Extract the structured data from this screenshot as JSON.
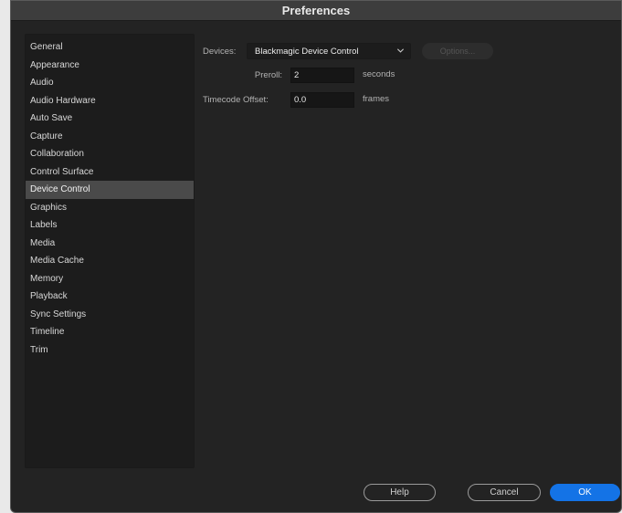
{
  "window": {
    "title": "Preferences"
  },
  "sidebar": {
    "items": [
      {
        "label": "General"
      },
      {
        "label": "Appearance"
      },
      {
        "label": "Audio"
      },
      {
        "label": "Audio Hardware"
      },
      {
        "label": "Auto Save"
      },
      {
        "label": "Capture"
      },
      {
        "label": "Collaboration"
      },
      {
        "label": "Control Surface"
      },
      {
        "label": "Device Control",
        "selected": true
      },
      {
        "label": "Graphics"
      },
      {
        "label": "Labels"
      },
      {
        "label": "Media"
      },
      {
        "label": "Media Cache"
      },
      {
        "label": "Memory"
      },
      {
        "label": "Playback"
      },
      {
        "label": "Sync Settings"
      },
      {
        "label": "Timeline"
      },
      {
        "label": "Trim"
      }
    ]
  },
  "device_control": {
    "devices_label": "Devices:",
    "devices_value": "Blackmagic Device Control",
    "options_label": "Options...",
    "preroll_label": "Preroll:",
    "preroll_value": "2",
    "preroll_unit": "seconds",
    "timecode_label": "Timecode Offset:",
    "timecode_value": "0.0",
    "timecode_unit": "frames"
  },
  "footer": {
    "help_label": "Help",
    "cancel_label": "Cancel",
    "ok_label": "OK"
  },
  "colors": {
    "accent": "#1473e6",
    "selected_item_bg": "#4a4a4a",
    "panel_bg": "#232323"
  }
}
